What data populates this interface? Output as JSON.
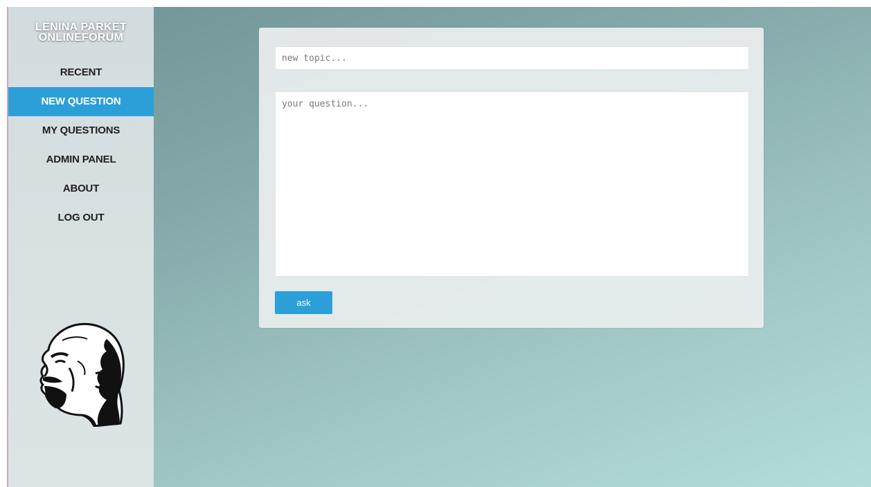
{
  "app": {
    "brand_line1": "LENINA PARKET",
    "brand_line2": "ONLINEFORUM"
  },
  "nav": {
    "items": [
      {
        "label": "RECENT",
        "active": false
      },
      {
        "label": "NEW QUESTION",
        "active": true
      },
      {
        "label": "MY QUESTIONS",
        "active": false
      },
      {
        "label": "ADMIN PANEL",
        "active": false
      },
      {
        "label": "ABOUT",
        "active": false
      },
      {
        "label": "LOG OUT",
        "active": false
      }
    ]
  },
  "form": {
    "topic_placeholder": "new topic...",
    "topic_value": "",
    "question_placeholder": "your question...",
    "question_value": "",
    "submit_label": "ask"
  },
  "icons": {
    "portrait": "lenin-portrait-icon"
  },
  "colors": {
    "accent": "#2d9fd8",
    "sidebar_bg": "#d9e1e2",
    "background_dark": "#6f9295",
    "background_light": "#b3dcd8",
    "panel_bg": "#e9eeee"
  }
}
